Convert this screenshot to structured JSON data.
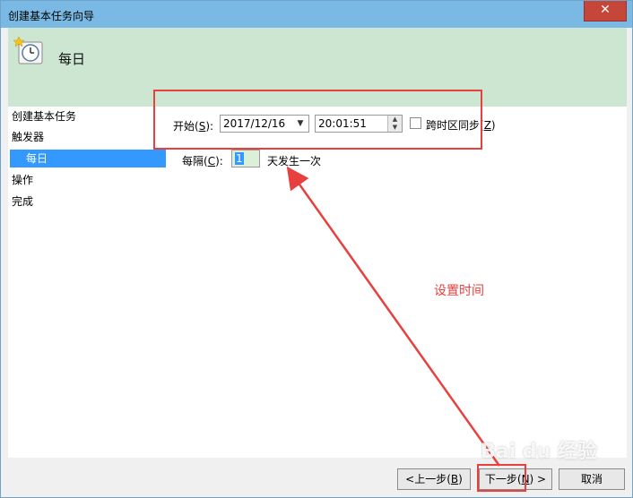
{
  "window": {
    "title": "创建基本任务向导",
    "close_glyph": "✕"
  },
  "header": {
    "heading": "每日",
    "icon": "clock-icon"
  },
  "nav": {
    "items": [
      {
        "label": "创建基本任务"
      },
      {
        "label": "触发器"
      },
      {
        "label": "每日"
      },
      {
        "label": "操作"
      },
      {
        "label": "完成"
      }
    ],
    "selected_index": 2
  },
  "form": {
    "start_label": "开始(",
    "start_key": "S",
    "start_close": "):",
    "date_value": "2017/12/16",
    "time_value": "20:01:51",
    "sync_label": "跨时区同步(",
    "sync_key": "Z",
    "sync_close": ")",
    "sync_checked": false,
    "interval_label": "每隔(",
    "interval_key": "C",
    "interval_close": "):",
    "interval_value": "1",
    "interval_suffix": "天发生一次"
  },
  "buttons": {
    "back": {
      "label": "<上一步(",
      "key": "B",
      "close": ")"
    },
    "next": {
      "label": "下一步(",
      "key": "N",
      "close": ") >"
    },
    "cancel": {
      "label": "取消"
    }
  },
  "annotation": {
    "text": "设置时间",
    "color": "#e8403e"
  },
  "watermark": {
    "text": "Bai du 经验"
  }
}
